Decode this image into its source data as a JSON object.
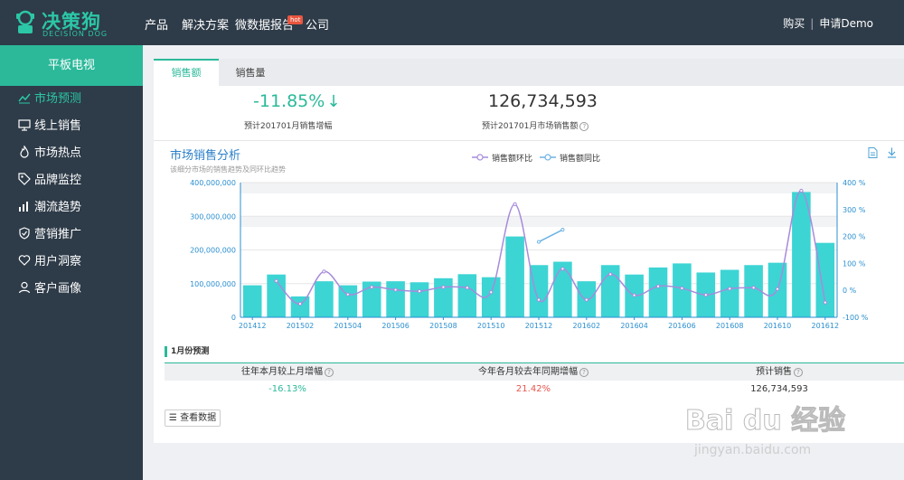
{
  "logo": {
    "cn": "决策狗",
    "en": "DECISION DOG"
  },
  "nav": {
    "items": [
      "产品",
      "解决方案",
      "微数据报告",
      "公司"
    ],
    "hot_badge": "hot"
  },
  "top_right": {
    "buy": "购买",
    "sep": "|",
    "demo": "申请Demo"
  },
  "sidebar": {
    "category": "平板电视",
    "items": [
      {
        "label": "市场预测",
        "icon": "trend-icon"
      },
      {
        "label": "线上销售",
        "icon": "monitor-icon"
      },
      {
        "label": "市场热点",
        "icon": "flame-icon"
      },
      {
        "label": "品牌监控",
        "icon": "tag-icon"
      },
      {
        "label": "潮流趋势",
        "icon": "bar-chart-icon"
      },
      {
        "label": "营销推广",
        "icon": "shield-check-icon"
      },
      {
        "label": "用户洞察",
        "icon": "heart-icon"
      },
      {
        "label": "客户画像",
        "icon": "user-icon"
      }
    ]
  },
  "tabs": {
    "active": "销售额",
    "other": "销售量"
  },
  "kpi": {
    "growth_value": "-11.85%",
    "growth_arrow": "↓",
    "growth_label": "预计201701月销售增幅",
    "sales_value": "126,734,593",
    "sales_label": "预计201701月市场销售额"
  },
  "chart_header": {
    "title": "市场销售分析",
    "subtitle": "该细分市场的销售趋势及同环比趋势",
    "legend_mom": "销售额环比",
    "legend_yoy": "销售额同比"
  },
  "chart_data": {
    "type": "bar",
    "categories": [
      "201412",
      "201501",
      "201502",
      "201503",
      "201504",
      "201505",
      "201506",
      "201507",
      "201508",
      "201509",
      "201510",
      "201511",
      "201512",
      "201601",
      "201602",
      "201603",
      "201604",
      "201605",
      "201606",
      "201607",
      "201608",
      "201609",
      "201610",
      "201611",
      "201612"
    ],
    "x_tick_labels": [
      "201412",
      "201502",
      "201504",
      "201506",
      "201508",
      "201510",
      "201512",
      "201602",
      "201604",
      "201606",
      "201608",
      "201610",
      "201612"
    ],
    "series": [
      {
        "name": "销售额",
        "type": "bar",
        "values": [
          95000000,
          127000000,
          62000000,
          107000000,
          95000000,
          106000000,
          107000000,
          104000000,
          116000000,
          128000000,
          119000000,
          240000000,
          155000000,
          165000000,
          107000000,
          155000000,
          127000000,
          148000000,
          160000000,
          133000000,
          141000000,
          155000000,
          162000000,
          372000000,
          221000000
        ]
      },
      {
        "name": "销售额环比",
        "type": "line",
        "values": [
          null,
          35,
          -50,
          70,
          -15,
          12,
          2,
          -3,
          12,
          10,
          -7,
          320,
          -35,
          80,
          -35,
          60,
          -18,
          15,
          8,
          -17,
          6,
          10,
          5,
          370,
          -45
        ]
      },
      {
        "name": "销售额同比",
        "type": "line",
        "values": [
          null,
          null,
          null,
          null,
          null,
          null,
          null,
          null,
          null,
          null,
          null,
          null,
          180,
          225,
          null,
          null,
          null,
          null,
          null,
          null,
          null,
          null,
          null,
          null,
          null
        ]
      }
    ],
    "y_left_ticks": [
      "0",
      "100,000,000",
      "200,000,000",
      "300,000,000",
      "400,000,000"
    ],
    "y_right_ticks": [
      "-100 %",
      "0 %",
      "100 %",
      "200 %",
      "300 %",
      "400 %"
    ],
    "ylim_left": [
      0,
      400000000
    ],
    "ylim_right": [
      -100,
      400
    ],
    "bar_color": "#3dd4d4",
    "mom_color": "#a78bdb",
    "yoy_color": "#6bb3e6"
  },
  "forecast": {
    "title": "1月份预测",
    "headers": [
      "往年本月较上月增幅",
      "今年各月较去年同期增幅",
      "预计销售"
    ],
    "values": [
      "-16.13%",
      "21.42%",
      "126,734,593"
    ],
    "view_button": "查看数据"
  },
  "watermark": {
    "main": "Bai du 经验",
    "url": "jingyan.baidu.com"
  },
  "colors": {
    "accent": "#2bb99a",
    "header_bg": "#2e3b48",
    "negative": "#e8554e"
  }
}
